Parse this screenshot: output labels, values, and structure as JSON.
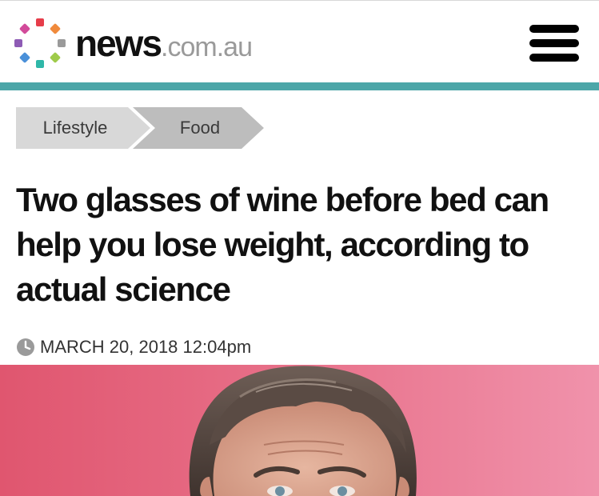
{
  "site": {
    "name": "news",
    "domain": ".com.au",
    "menu_icon": "hamburger-menu-icon"
  },
  "colors": {
    "accent": "#4ca6a8",
    "breadcrumb_bg": "#d8d8d8",
    "breadcrumb_active_bg": "#bdbdbd",
    "headline": "#111111",
    "logo_dots": [
      "#e63d4a",
      "#f08a3c",
      "#9a9a9a",
      "#9fcb4a",
      "#2fb7a8",
      "#4a90d9",
      "#8e5bb5",
      "#d24a9a"
    ]
  },
  "breadcrumb": {
    "items": [
      {
        "label": "Lifestyle"
      },
      {
        "label": "Food"
      }
    ]
  },
  "article": {
    "headline": "Two glasses of wine before bed can help you lose weight, according to actual science",
    "date": "MARCH 20, 2018 12:04pm",
    "date_icon": "clock-icon",
    "hero_image": "photo-of-man-portrait"
  }
}
